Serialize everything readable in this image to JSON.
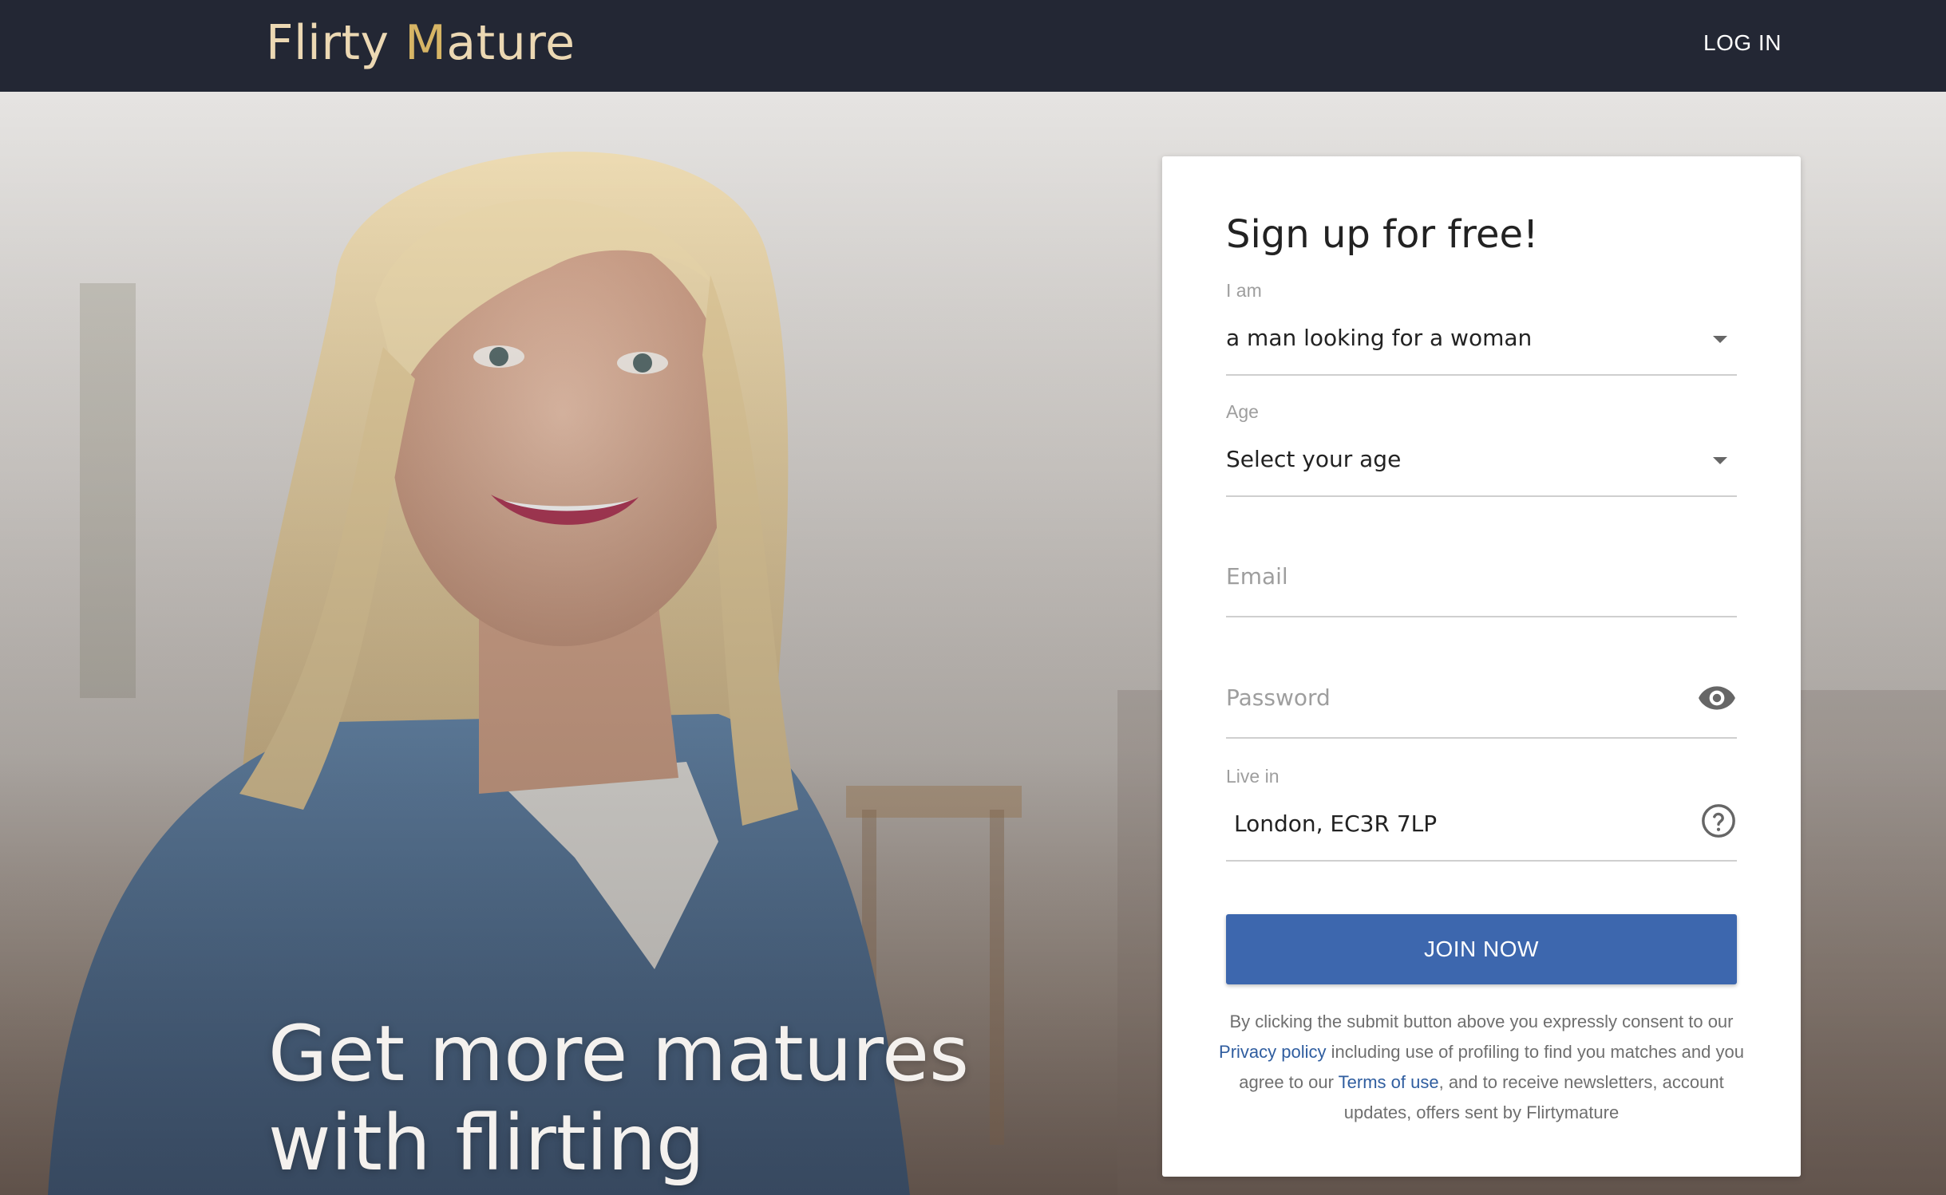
{
  "header": {
    "logo_part1": "Flirty ",
    "logo_m": "M",
    "logo_part2": "ature",
    "login_label": "LOG IN"
  },
  "hero": {
    "headline_line1": "Get more matures",
    "headline_line2": "with flirting"
  },
  "signup": {
    "title": "Sign up for free!",
    "iam_label": "I am",
    "iam_value": "a man looking for a woman",
    "age_label": "Age",
    "age_value": "Select your age",
    "email_placeholder": "Email",
    "password_placeholder": "Password",
    "live_label": "Live in",
    "live_value": "London, EC3R 7LP",
    "join_label": "JOIN NOW",
    "legal_pre": "By clicking the submit button above you expressly consent to our ",
    "privacy_link": "Privacy policy",
    "legal_mid": " including use of profiling to find you matches and you agree to our ",
    "terms_link": "Terms of use",
    "legal_post": ", and to receive newsletters, account updates, offers sent by Flirtymature"
  },
  "colors": {
    "topbar": "#232734",
    "logo": "#ecd8b3",
    "logo_accent": "#d7b565",
    "button": "#3d67ae",
    "link": "#2f5d9f"
  }
}
